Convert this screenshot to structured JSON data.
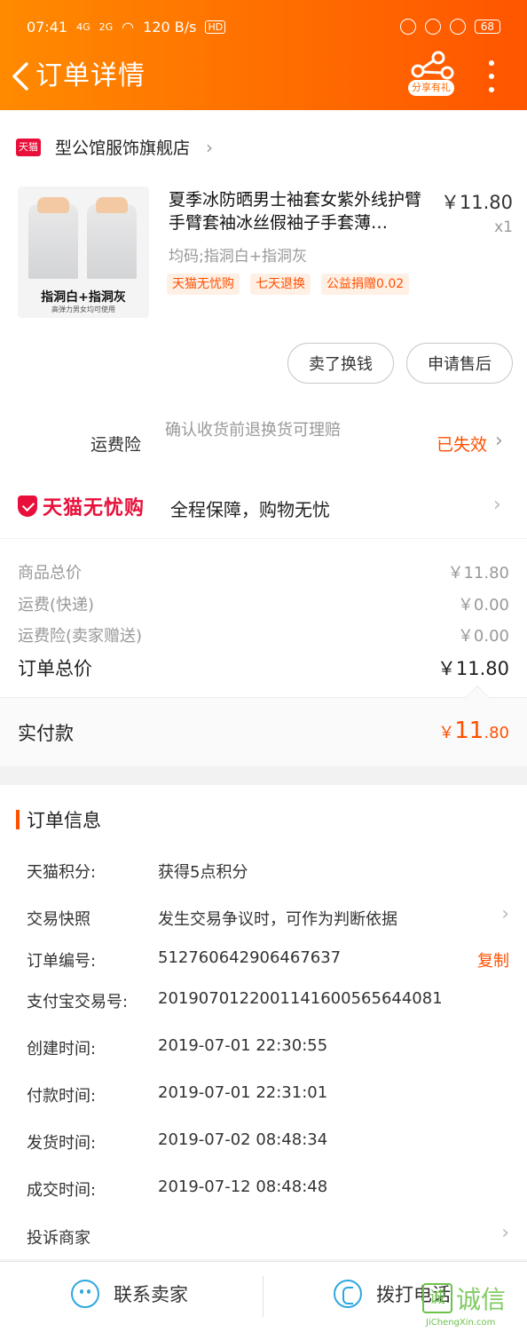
{
  "status_bar": {
    "time": "07:41",
    "net1": "4G",
    "net2": "2G",
    "speed": "120 B/s",
    "hd": "HD",
    "battery": "68"
  },
  "nav": {
    "title": "订单详情",
    "share_label": "分享有礼"
  },
  "store": {
    "badge": "天猫",
    "name": "型公馆服饰旗舰店"
  },
  "product": {
    "title": "夏季冰防晒男士袖套女紫外线护臂手臂套袖冰丝假袖子手套薄…",
    "price": "￥11.80",
    "qty": "x1",
    "sku": "均码;指洞白+指洞灰",
    "image_caption": "指洞白+指洞灰",
    "image_sub": "高弹力男女均可使用",
    "tags": [
      "天猫无忧购",
      "七天退换",
      "公益捐赠0.02"
    ]
  },
  "actions": {
    "sell": "卖了换钱",
    "after_sale": "申请售后"
  },
  "insurance": {
    "label": "运费险",
    "desc": "确认收货前退换货可理赔",
    "status": "已失效"
  },
  "wuyou": {
    "logo": "天猫无忧购",
    "desc": "全程保障，购物无忧"
  },
  "summary": {
    "goods_label": "商品总价",
    "goods_value": "￥11.80",
    "ship_label": "运费(快递)",
    "ship_value": "￥0.00",
    "ins_label": "运费险(卖家赠送)",
    "ins_value": "￥0.00",
    "total_label": "订单总价",
    "total_value": "￥11.80",
    "paid_label": "实付款",
    "paid_currency": "￥",
    "paid_int": "11",
    "paid_dec": ".80"
  },
  "order_info": {
    "title": "订单信息",
    "points_label": "天猫积分:",
    "points_value": "获得5点积分",
    "snapshot_label": "交易快照",
    "snapshot_value": "发生交易争议时，可作为判断依据",
    "order_no_label": "订单编号:",
    "order_no_value": "512760642906467637",
    "copy": "复制",
    "alipay_label": "支付宝交易号:",
    "alipay_value": "2019070122001141600565644081",
    "created_label": "创建时间:",
    "created_value": "2019-07-01 22:30:55",
    "paid_label": "付款时间:",
    "paid_value": "2019-07-01 22:31:01",
    "shipped_label": "发货时间:",
    "shipped_value": "2019-07-02 08:48:34",
    "done_label": "成交时间:",
    "done_value": "2019-07-12 08:48:48",
    "complain_label": "投诉商家"
  },
  "bottom": {
    "contact": "联系卖家",
    "call": "拨打电话"
  },
  "watermark": {
    "box": "诚",
    "text": "诚信",
    "url": "JiChengXin.com"
  },
  "colors": {
    "brand": "#ff6a00",
    "accent": "#ff5000",
    "tmall_red": "#e8103a",
    "icon_blue": "#2ea7e0"
  }
}
